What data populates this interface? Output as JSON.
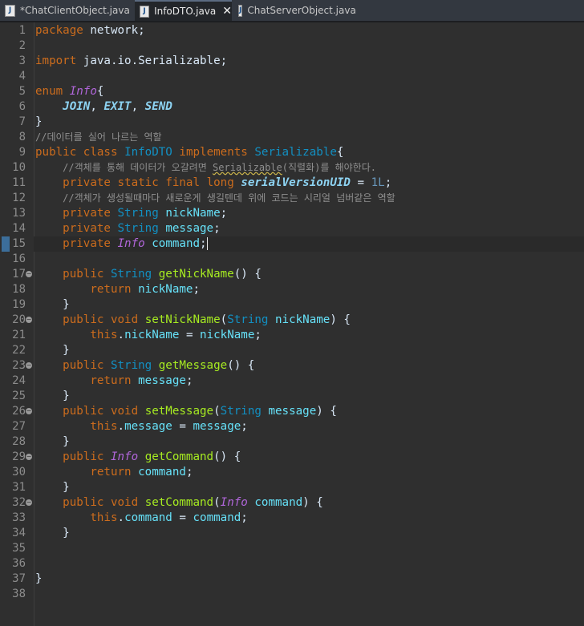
{
  "tabs": [
    {
      "label": "*ChatClientObject.java",
      "active": false
    },
    {
      "label": "InfoDTO.java",
      "active": true
    },
    {
      "label": "ChatServerObject.java",
      "active": false
    }
  ],
  "tab_icon_label": "J",
  "close_glyph": "✕",
  "fold_glyph": "−",
  "line_numbers": [
    "1",
    "2",
    "3",
    "4",
    "5",
    "6",
    "7",
    "8",
    "9",
    "10",
    "11",
    "12",
    "13",
    "14",
    "15",
    "16",
    "17",
    "18",
    "19",
    "20",
    "21",
    "22",
    "23",
    "24",
    "25",
    "26",
    "27",
    "28",
    "29",
    "30",
    "31",
    "32",
    "33",
    "34",
    "35",
    "36",
    "37",
    "38"
  ],
  "fold_lines": [
    "17",
    "20",
    "23",
    "26",
    "29",
    "32"
  ],
  "current_line": "15",
  "code_lines": [
    [
      {
        "t": "package",
        "c": "kw"
      },
      {
        "t": " network;"
      }
    ],
    [],
    [
      {
        "t": "import",
        "c": "kw"
      },
      {
        "t": " java.io.Serializable;"
      }
    ],
    [],
    [
      {
        "t": "enum",
        "c": "kw"
      },
      {
        "t": " "
      },
      {
        "t": "Info",
        "c": "en"
      },
      {
        "t": "{"
      }
    ],
    [
      {
        "t": "    "
      },
      {
        "t": "JOIN",
        "c": "ec"
      },
      {
        "t": ", "
      },
      {
        "t": "EXIT",
        "c": "ec"
      },
      {
        "t": ", "
      },
      {
        "t": "SEND",
        "c": "ec"
      }
    ],
    [
      {
        "t": "}"
      }
    ],
    [
      {
        "t": "//데이터를 실어 나르는 역할",
        "c": "cm"
      }
    ],
    [
      {
        "t": "public",
        "c": "kw"
      },
      {
        "t": " "
      },
      {
        "t": "class",
        "c": "kw"
      },
      {
        "t": " "
      },
      {
        "t": "InfoDTO",
        "c": "ty"
      },
      {
        "t": " "
      },
      {
        "t": "implements",
        "c": "kw"
      },
      {
        "t": " "
      },
      {
        "t": "Serializable",
        "c": "ty"
      },
      {
        "t": "{"
      }
    ],
    [
      {
        "t": "    "
      },
      {
        "t": "//객체를 통해 데이터가 오갈려면 ",
        "c": "cm"
      },
      {
        "t": "Serializable",
        "c": "cm wavy"
      },
      {
        "t": "(직렬화)를 해야한다.",
        "c": "cm"
      }
    ],
    [
      {
        "t": "    "
      },
      {
        "t": "private",
        "c": "kw"
      },
      {
        "t": " "
      },
      {
        "t": "static",
        "c": "kw"
      },
      {
        "t": " "
      },
      {
        "t": "final",
        "c": "kw"
      },
      {
        "t": " "
      },
      {
        "t": "long",
        "c": "kw"
      },
      {
        "t": " "
      },
      {
        "t": "serialVersionUID",
        "c": "st"
      },
      {
        "t": " = "
      },
      {
        "t": "1L",
        "c": "num"
      },
      {
        "t": ";"
      }
    ],
    [
      {
        "t": "    "
      },
      {
        "t": "//객체가 생성될때마다 새로운게 생길텐데 위에 코드는 시리얼 넘버같은 역할",
        "c": "cm"
      }
    ],
    [
      {
        "t": "    "
      },
      {
        "t": "private",
        "c": "kw"
      },
      {
        "t": " "
      },
      {
        "t": "String",
        "c": "ty"
      },
      {
        "t": " "
      },
      {
        "t": "nickName",
        "c": "fld"
      },
      {
        "t": ";"
      }
    ],
    [
      {
        "t": "    "
      },
      {
        "t": "private",
        "c": "kw"
      },
      {
        "t": " "
      },
      {
        "t": "String",
        "c": "ty"
      },
      {
        "t": " "
      },
      {
        "t": "message",
        "c": "fld"
      },
      {
        "t": ";"
      }
    ],
    [
      {
        "t": "    "
      },
      {
        "t": "private",
        "c": "kw"
      },
      {
        "t": " "
      },
      {
        "t": "Info",
        "c": "en"
      },
      {
        "t": " "
      },
      {
        "t": "command",
        "c": "fld"
      },
      {
        "t": ";"
      }
    ],
    [],
    [
      {
        "t": "    "
      },
      {
        "t": "public",
        "c": "kw"
      },
      {
        "t": " "
      },
      {
        "t": "String",
        "c": "ty"
      },
      {
        "t": " "
      },
      {
        "t": "getNickName",
        "c": "mth"
      },
      {
        "t": "() {"
      }
    ],
    [
      {
        "t": "        "
      },
      {
        "t": "return",
        "c": "kw"
      },
      {
        "t": " "
      },
      {
        "t": "nickName",
        "c": "fld"
      },
      {
        "t": ";"
      }
    ],
    [
      {
        "t": "    }"
      }
    ],
    [
      {
        "t": "    "
      },
      {
        "t": "public",
        "c": "kw"
      },
      {
        "t": " "
      },
      {
        "t": "void",
        "c": "kw"
      },
      {
        "t": " "
      },
      {
        "t": "setNickName",
        "c": "mth"
      },
      {
        "t": "("
      },
      {
        "t": "String",
        "c": "ty"
      },
      {
        "t": " "
      },
      {
        "t": "nickName",
        "c": "fld"
      },
      {
        "t": ") {"
      }
    ],
    [
      {
        "t": "        "
      },
      {
        "t": "this",
        "c": "kw"
      },
      {
        "t": "."
      },
      {
        "t": "nickName",
        "c": "fld"
      },
      {
        "t": " = "
      },
      {
        "t": "nickName",
        "c": "fld"
      },
      {
        "t": ";"
      }
    ],
    [
      {
        "t": "    }"
      }
    ],
    [
      {
        "t": "    "
      },
      {
        "t": "public",
        "c": "kw"
      },
      {
        "t": " "
      },
      {
        "t": "String",
        "c": "ty"
      },
      {
        "t": " "
      },
      {
        "t": "getMessage",
        "c": "mth"
      },
      {
        "t": "() {"
      }
    ],
    [
      {
        "t": "        "
      },
      {
        "t": "return",
        "c": "kw"
      },
      {
        "t": " "
      },
      {
        "t": "message",
        "c": "fld"
      },
      {
        "t": ";"
      }
    ],
    [
      {
        "t": "    }"
      }
    ],
    [
      {
        "t": "    "
      },
      {
        "t": "public",
        "c": "kw"
      },
      {
        "t": " "
      },
      {
        "t": "void",
        "c": "kw"
      },
      {
        "t": " "
      },
      {
        "t": "setMessage",
        "c": "mth"
      },
      {
        "t": "("
      },
      {
        "t": "String",
        "c": "ty"
      },
      {
        "t": " "
      },
      {
        "t": "message",
        "c": "fld"
      },
      {
        "t": ") {"
      }
    ],
    [
      {
        "t": "        "
      },
      {
        "t": "this",
        "c": "kw"
      },
      {
        "t": "."
      },
      {
        "t": "message",
        "c": "fld"
      },
      {
        "t": " = "
      },
      {
        "t": "message",
        "c": "fld"
      },
      {
        "t": ";"
      }
    ],
    [
      {
        "t": "    }"
      }
    ],
    [
      {
        "t": "    "
      },
      {
        "t": "public",
        "c": "kw"
      },
      {
        "t": " "
      },
      {
        "t": "Info",
        "c": "en"
      },
      {
        "t": " "
      },
      {
        "t": "getCommand",
        "c": "mth"
      },
      {
        "t": "() {"
      }
    ],
    [
      {
        "t": "        "
      },
      {
        "t": "return",
        "c": "kw"
      },
      {
        "t": " "
      },
      {
        "t": "command",
        "c": "fld"
      },
      {
        "t": ";"
      }
    ],
    [
      {
        "t": "    }"
      }
    ],
    [
      {
        "t": "    "
      },
      {
        "t": "public",
        "c": "kw"
      },
      {
        "t": " "
      },
      {
        "t": "void",
        "c": "kw"
      },
      {
        "t": " "
      },
      {
        "t": "setCommand",
        "c": "mth"
      },
      {
        "t": "("
      },
      {
        "t": "Info",
        "c": "en"
      },
      {
        "t": " "
      },
      {
        "t": "command",
        "c": "fld"
      },
      {
        "t": ") {"
      }
    ],
    [
      {
        "t": "        "
      },
      {
        "t": "this",
        "c": "kw"
      },
      {
        "t": "."
      },
      {
        "t": "command",
        "c": "fld"
      },
      {
        "t": " = "
      },
      {
        "t": "command",
        "c": "fld"
      },
      {
        "t": ";"
      }
    ],
    [
      {
        "t": "    }"
      }
    ],
    [],
    [],
    [
      {
        "t": "}"
      }
    ],
    []
  ]
}
